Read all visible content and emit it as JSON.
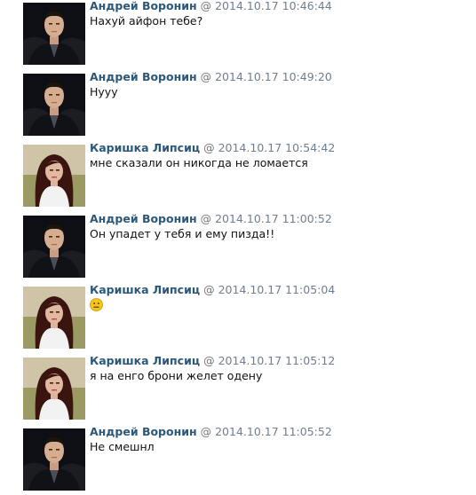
{
  "messages": [
    {
      "author": "Андрей Воронин",
      "separator": "@",
      "timestamp": "2014.10.17 10:46:44",
      "text": "Нахуй айфон тебе?",
      "avatar": "avatar-male"
    },
    {
      "author": "Андрей Воронин",
      "separator": "@",
      "timestamp": "2014.10.17 10:49:20",
      "text": "Нууу",
      "avatar": "avatar-male"
    },
    {
      "author": "Каришка Липсиц",
      "separator": "@",
      "timestamp": "2014.10.17 10:54:42",
      "text": "мне сказали он никогда не ломается",
      "avatar": "avatar-female"
    },
    {
      "author": "Андрей Воронин",
      "separator": "@",
      "timestamp": "2014.10.17 11:00:52",
      "text": "Он упадет у тебя и ему пизда!!",
      "avatar": "avatar-male"
    },
    {
      "author": "Каришка Липсиц",
      "separator": "@",
      "timestamp": "2014.10.17 11:05:04",
      "text": "",
      "emoji": "neutral-smiley-icon",
      "avatar": "avatar-female"
    },
    {
      "author": "Каришка Липсиц",
      "separator": "@",
      "timestamp": "2014.10.17 11:05:12",
      "text": "я на енго брони желет одену",
      "avatar": "avatar-female"
    },
    {
      "author": "Андрей Воронин",
      "separator": "@",
      "timestamp": "2014.10.17 11:05:52",
      "text": "Не смешнл",
      "avatar": "avatar-male"
    }
  ],
  "colors": {
    "author": "#2b587a",
    "timestamp": "#6b7f94",
    "text": "#111111",
    "smiley": "#f5c518"
  }
}
